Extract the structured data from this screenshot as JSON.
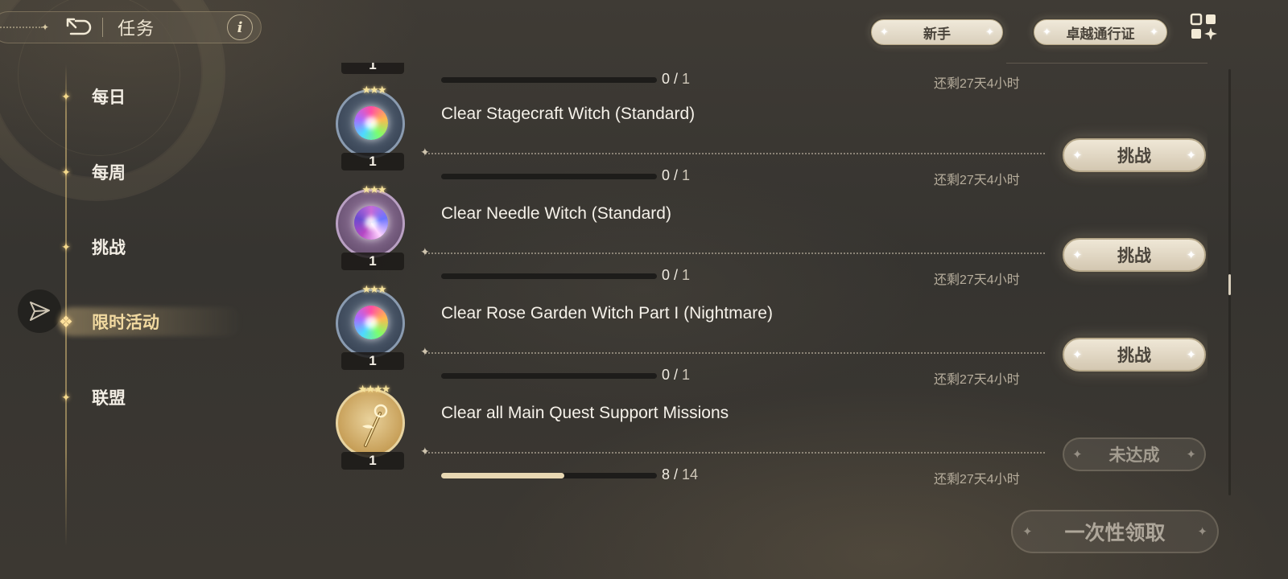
{
  "header": {
    "title": "任务",
    "back_icon": "back-arrow-icon",
    "info_label": "i"
  },
  "nav": {
    "items": [
      {
        "label": "每日",
        "active": false
      },
      {
        "label": "每周",
        "active": false
      },
      {
        "label": "挑战",
        "active": false
      },
      {
        "label": "限时活动",
        "active": true
      },
      {
        "label": "联盟",
        "active": false
      }
    ]
  },
  "top_buttons": {
    "novice": "新手",
    "pass": "卓越通行证"
  },
  "tasks": [
    {
      "title": "",
      "progress": {
        "current": "0",
        "total": "1",
        "fraction": 0
      },
      "remaining": "还剩27天4小时",
      "reward_qty": "1",
      "action": "",
      "partial": true
    },
    {
      "title": "Clear Stagecraft Witch (Standard)",
      "progress": {
        "current": "0",
        "total": "1",
        "fraction": 0
      },
      "remaining": "还剩27天4小时",
      "reward_qty": "1",
      "reward_icon": "rainbow-orb-icon",
      "action": "挑战"
    },
    {
      "title": "Clear Needle Witch (Standard)",
      "progress": {
        "current": "0",
        "total": "1",
        "fraction": 0
      },
      "remaining": "还剩27天4小时",
      "reward_qty": "1",
      "reward_icon": "violet-orb-icon",
      "action": "挑战"
    },
    {
      "title": "Clear Rose Garden Witch Part I (Nightmare)",
      "progress": {
        "current": "0",
        "total": "1",
        "fraction": 0
      },
      "remaining": "还剩27天4小时",
      "reward_qty": "1",
      "reward_icon": "rainbow-orb-icon",
      "action": "挑战"
    },
    {
      "title": "Clear all Main Quest Support Missions",
      "progress": {
        "current": "8",
        "total": "14",
        "fraction": 0.5714
      },
      "remaining": "还剩27天4小时",
      "reward_qty": "1",
      "reward_icon": "golden-wand-icon",
      "action": "未达成"
    }
  ],
  "claim_all": "一次性领取",
  "colors": {
    "accent_gold": "#f4d98c",
    "button_face": "#efe7d6",
    "button_text": "#4b453c",
    "progress_fill": "#e8d8b3"
  }
}
